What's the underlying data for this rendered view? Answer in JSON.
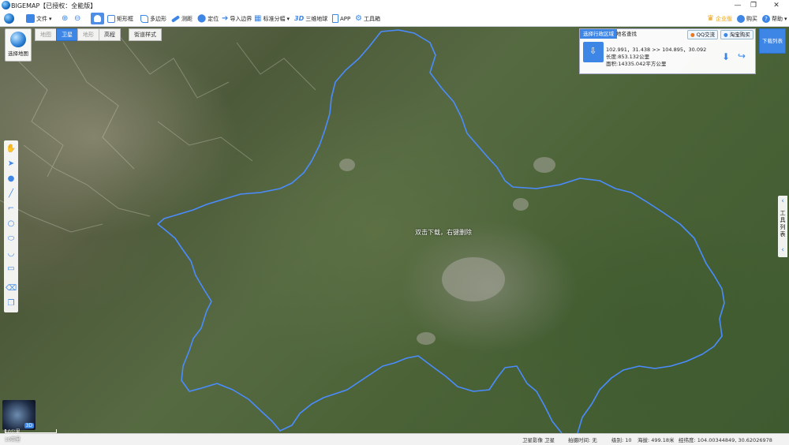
{
  "app": {
    "title": "BIGEMAP【已授权：全能版】"
  },
  "window": {
    "minimize": "—",
    "restore": "❐",
    "close": "✕"
  },
  "toolbar": {
    "items": [
      {
        "label": "文件",
        "icon": "folder-icon"
      },
      {
        "label": "",
        "icon": "zoom-in-icon"
      },
      {
        "label": "",
        "icon": "zoom-out-icon"
      },
      {
        "label": "",
        "icon": "hand-icon"
      },
      {
        "label": "矩形框",
        "icon": "rectangle-icon"
      },
      {
        "label": "多边形",
        "icon": "polygon-icon"
      },
      {
        "label": "测距",
        "icon": "ruler-icon"
      },
      {
        "label": "定位",
        "icon": "location-icon"
      },
      {
        "label": "导入边界",
        "icon": "import-icon"
      },
      {
        "label": "标准分幅",
        "icon": "grid-icon"
      },
      {
        "label": "三维地球",
        "icon": "3d-icon"
      },
      {
        "label": "APP",
        "icon": "phone-icon"
      },
      {
        "label": "工具箱",
        "icon": "gear-icon"
      }
    ],
    "threed_text": "3D",
    "right": {
      "enterprise": "企业版",
      "feedback": "购买",
      "help": "帮助"
    }
  },
  "map_modes": {
    "select_map": "选择地图",
    "tabs": [
      "地图",
      "卫星",
      "地形",
      "高程",
      "街道样式"
    ],
    "selected": "卫星"
  },
  "panel": {
    "tab_admin": "选择行政区域",
    "tab_search": "地名查找",
    "qq": "QQ交流",
    "taobao": "淘宝购买",
    "coords": "102.991，31.438 >> 104.895，30.092",
    "length": "长度:853.132公里",
    "area": "面积:14335.042平方公里"
  },
  "download_list": "下载列表",
  "right_toolbox": {
    "label": "工具列表"
  },
  "hint": "双击下载，右键删除",
  "minimap": {
    "label3d": "3D"
  },
  "scale": {
    "top": "10公里",
    "bottom": "10英里"
  },
  "status": {
    "source": "卫星影像 卫星",
    "capture": "拍摄时间: 无",
    "level": "级别: 10",
    "altitude": "海拔: 499.18米",
    "coords": "经纬度: 104.00344849, 30.62026978"
  },
  "colors": {
    "accent": "#3d86e6",
    "boundary": "#4a8cff"
  }
}
